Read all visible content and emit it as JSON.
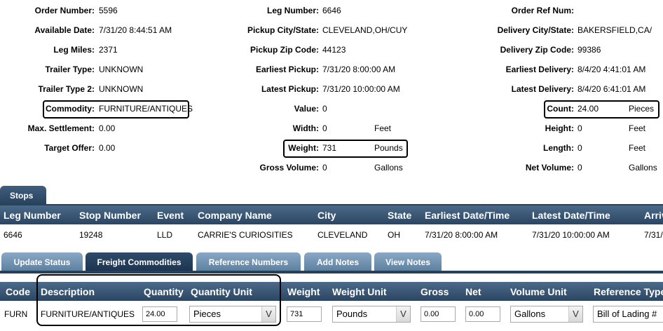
{
  "details": {
    "col1": [
      {
        "label": "Order Number:",
        "value": "5596"
      },
      {
        "label": "Available Date:",
        "value": "7/31/20 8:44:51 AM"
      },
      {
        "label": "Leg Miles:",
        "value": "2371"
      },
      {
        "label": "Trailer Type:",
        "value": "UNKNOWN"
      },
      {
        "label": "Trailer Type 2:",
        "value": "UNKNOWN"
      },
      {
        "label": "Commodity:",
        "value": "FURNITURE/ANTIQUES"
      },
      {
        "label": "Max. Settlement:",
        "value": "0.00"
      },
      {
        "label": "Target Offer:",
        "value": "0.00"
      }
    ],
    "col2": [
      {
        "label": "Leg Number:",
        "value": "6646",
        "unit": ""
      },
      {
        "label": "Pickup City/State:",
        "value": "CLEVELAND,OH/CUY",
        "unit": ""
      },
      {
        "label": "Pickup Zip Code:",
        "value": "44123",
        "unit": ""
      },
      {
        "label": "Earliest Pickup:",
        "value": "7/31/20 8:00:00 AM",
        "unit": ""
      },
      {
        "label": "Latest Pickup:",
        "value": "7/31/20 10:00:00 AM",
        "unit": ""
      },
      {
        "label": "Value:",
        "value": "0",
        "unit": ""
      },
      {
        "label": "Width:",
        "value": "0",
        "unit": "Feet"
      },
      {
        "label": "Weight:",
        "value": "731",
        "unit": "Pounds"
      },
      {
        "label": "Gross Volume:",
        "value": "0",
        "unit": "Gallons"
      }
    ],
    "col3": [
      {
        "label": "Order Ref Num:",
        "value": "",
        "unit": ""
      },
      {
        "label": "Delivery City/State:",
        "value": "BAKERSFIELD,CA/",
        "unit": ""
      },
      {
        "label": "Delivery Zip Code:",
        "value": "99386",
        "unit": ""
      },
      {
        "label": "Earliest Delivery:",
        "value": "8/4/20 4:41:01 AM",
        "unit": ""
      },
      {
        "label": "Latest Delivery:",
        "value": "8/4/20 6:41:01 AM",
        "unit": ""
      },
      {
        "label": "Count:",
        "value": "24.00",
        "unit": "Pieces"
      },
      {
        "label": "Height:",
        "value": "0",
        "unit": "Feet"
      },
      {
        "label": "Length:",
        "value": "0",
        "unit": "Feet"
      },
      {
        "label": "Net Volume:",
        "value": "0",
        "unit": "Gallons"
      }
    ]
  },
  "stops": {
    "tab_label": "Stops",
    "headers": [
      "Leg Number",
      "Stop Number",
      "Event",
      "Company Name",
      "City",
      "State",
      "Earliest Date/Time",
      "Latest Date/Time",
      "Arriv"
    ],
    "row": [
      "6646",
      "19248",
      "LLD",
      "CARRIE'S CURIOSITIES",
      "CLEVELAND",
      "OH",
      "7/31/20 8:00:00 AM",
      "7/31/20 10:00:00 AM",
      "7/31/"
    ]
  },
  "tabs": [
    "Update Status",
    "Freight Commodities",
    "Reference Numbers",
    "Add Notes",
    "View Notes"
  ],
  "freight": {
    "headers": [
      "Code",
      "Description",
      "Quantity",
      "Quantity Unit",
      "Weight",
      "Weight Unit",
      "Gross",
      "Net",
      "Volume Unit",
      "Reference Type"
    ],
    "row": {
      "code": "FURN",
      "description": "FURNITURE/ANTIQUES",
      "quantity": "24.00",
      "quantity_unit": "Pieces",
      "weight": "731",
      "weight_unit": "Pounds",
      "gross": "0.00",
      "net": "0.00",
      "volume_unit": "Gallons",
      "reference_type": "Bill of Lading #"
    },
    "dropdown_arrow": "V"
  }
}
